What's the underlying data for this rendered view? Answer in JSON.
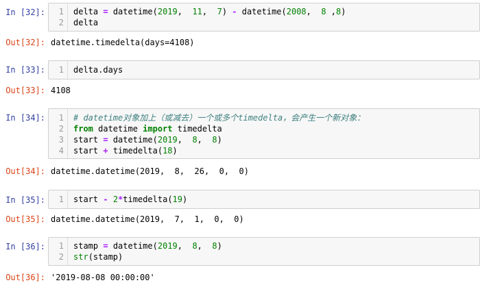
{
  "cells": [
    {
      "in_prompt": "In [32]:",
      "lines": [
        [
          {
            "t": "delta "
          },
          {
            "t": "=",
            "c": "op"
          },
          {
            "t": " datetime("
          },
          {
            "t": "2019",
            "c": "num"
          },
          {
            "t": ",  "
          },
          {
            "t": "11",
            "c": "num"
          },
          {
            "t": ",  "
          },
          {
            "t": "7",
            "c": "num"
          },
          {
            "t": ") "
          },
          {
            "t": "-",
            "c": "op"
          },
          {
            "t": " datetime("
          },
          {
            "t": "2008",
            "c": "num"
          },
          {
            "t": ",  "
          },
          {
            "t": "8",
            "c": "num"
          },
          {
            "t": " ,"
          },
          {
            "t": "8",
            "c": "num"
          },
          {
            "t": ")"
          }
        ],
        [
          {
            "t": "delta"
          }
        ]
      ],
      "out_prompt": "Out[32]:",
      "output": "datetime.timedelta(days=4108)"
    },
    {
      "in_prompt": "In [33]:",
      "lines": [
        [
          {
            "t": "delta.days"
          }
        ]
      ],
      "out_prompt": "Out[33]:",
      "output": "4108"
    },
    {
      "in_prompt": "In [34]:",
      "lines": [
        [
          {
            "t": "# datetime对象加上（或减去）一个或多个timedelta，会产生一个新对象：",
            "c": "cm"
          }
        ],
        [
          {
            "t": "from",
            "c": "kw"
          },
          {
            "t": " datetime "
          },
          {
            "t": "import",
            "c": "kw"
          },
          {
            "t": " timedelta"
          }
        ],
        [
          {
            "t": "start "
          },
          {
            "t": "=",
            "c": "op"
          },
          {
            "t": " datetime("
          },
          {
            "t": "2019",
            "c": "num"
          },
          {
            "t": ",  "
          },
          {
            "t": "8",
            "c": "num"
          },
          {
            "t": ",  "
          },
          {
            "t": "8",
            "c": "num"
          },
          {
            "t": ")"
          }
        ],
        [
          {
            "t": "start "
          },
          {
            "t": "+",
            "c": "op"
          },
          {
            "t": " timedelta("
          },
          {
            "t": "18",
            "c": "num"
          },
          {
            "t": ")"
          }
        ]
      ],
      "out_prompt": "Out[34]:",
      "output": "datetime.datetime(2019,  8,  26,  0,  0)"
    },
    {
      "in_prompt": "In [35]:",
      "lines": [
        [
          {
            "t": "start "
          },
          {
            "t": "-",
            "c": "op"
          },
          {
            "t": " "
          },
          {
            "t": "2",
            "c": "num"
          },
          {
            "t": "*",
            "c": "op"
          },
          {
            "t": "timedelta("
          },
          {
            "t": "19",
            "c": "num"
          },
          {
            "t": ")"
          }
        ]
      ],
      "out_prompt": "Out[35]:",
      "output": "datetime.datetime(2019,  7,  1,  0,  0)"
    },
    {
      "in_prompt": "In [36]:",
      "lines": [
        [
          {
            "t": "stamp "
          },
          {
            "t": "=",
            "c": "op"
          },
          {
            "t": " datetime("
          },
          {
            "t": "2019",
            "c": "num"
          },
          {
            "t": ",  "
          },
          {
            "t": "8",
            "c": "num"
          },
          {
            "t": ",  "
          },
          {
            "t": "8",
            "c": "num"
          },
          {
            "t": ")"
          }
        ],
        [
          {
            "t": "str",
            "c": "bi"
          },
          {
            "t": "(stamp)"
          }
        ]
      ],
      "out_prompt": "Out[36]:",
      "output": "'2019-08-08 00:00:00'"
    }
  ],
  "colors": {
    "in_prompt": "#303F9F",
    "out_prompt": "#D84315",
    "keyword": "#008000",
    "operator": "#AA22FF",
    "number": "#008000",
    "comment": "#408080",
    "cell_bg": "#f7f7f7"
  }
}
